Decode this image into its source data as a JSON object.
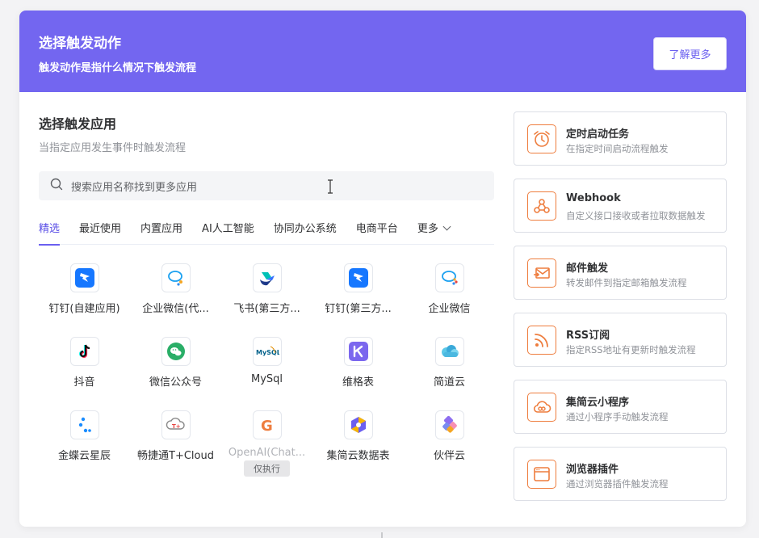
{
  "header": {
    "title": "选择触发动作",
    "subtitle": "触发动作是指什么情况下触发流程",
    "learn_more": "了解更多"
  },
  "left": {
    "title": "选择触发应用",
    "subtitle": "当指定应用发生事件时触发流程",
    "search_placeholder": "搜索应用名称找到更多应用"
  },
  "tabs": [
    {
      "label": "精选",
      "active": true
    },
    {
      "label": "最近使用"
    },
    {
      "label": "内置应用"
    },
    {
      "label": "AI人工智能"
    },
    {
      "label": "协同办公系统"
    },
    {
      "label": "电商平台"
    },
    {
      "label": "更多"
    }
  ],
  "apps": [
    {
      "name": "钉钉(自建应用)",
      "icon": "dingtalk-icon"
    },
    {
      "name": "企业微信(代...",
      "icon": "wecom-icon"
    },
    {
      "name": "飞书(第三方...",
      "icon": "feishu-icon"
    },
    {
      "name": "钉钉(第三方...",
      "icon": "dingtalk-icon"
    },
    {
      "name": "企业微信",
      "icon": "wecom-icon"
    },
    {
      "name": "抖音",
      "icon": "douyin-icon"
    },
    {
      "name": "微信公众号",
      "icon": "wechat-icon"
    },
    {
      "name": "MySql",
      "icon": "mysql-icon"
    },
    {
      "name": "维格表",
      "icon": "vika-icon"
    },
    {
      "name": "简道云",
      "icon": "jiandaoyun-icon"
    },
    {
      "name": "金蝶云星辰",
      "icon": "kingdee-icon"
    },
    {
      "name": "畅捷通T+Cloud",
      "icon": "chanjet-icon"
    },
    {
      "name": "OpenAI(Chat...",
      "icon": "openai-icon",
      "badge": "仅执行",
      "disabled": true
    },
    {
      "name": "集简云数据表",
      "icon": "jijianyun-table-icon"
    },
    {
      "name": "伙伴云",
      "icon": "huoban-icon"
    }
  ],
  "triggers": [
    {
      "title": "定时启动任务",
      "desc": "在指定时间启动流程触发",
      "icon": "alarm-clock-icon"
    },
    {
      "title": "Webhook",
      "desc": "自定义接口接收或者拉取数据触发",
      "icon": "webhook-icon"
    },
    {
      "title": "邮件触发",
      "desc": "转发邮件到指定邮箱触发流程",
      "icon": "mail-icon"
    },
    {
      "title": "RSS订阅",
      "desc": "指定RSS地址有更新时触发流程",
      "icon": "rss-icon"
    },
    {
      "title": "集简云小程序",
      "desc": "通过小程序手动触发流程",
      "icon": "cloud-icon"
    },
    {
      "title": "浏览器插件",
      "desc": "通过浏览器插件触发流程",
      "icon": "browser-icon"
    }
  ],
  "colors": {
    "primary": "#7366f0",
    "accent_orange": "#ee7d3e"
  }
}
